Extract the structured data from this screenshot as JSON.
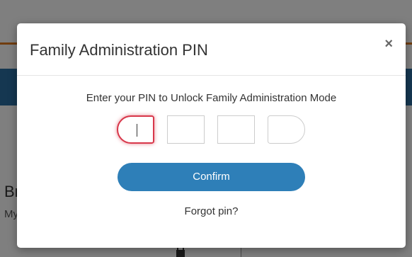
{
  "background": {
    "heading_fragment": "Br",
    "subtext_fragment": "My"
  },
  "modal": {
    "title": "Family Administration PIN",
    "close_label": "×",
    "prompt": "Enter your PIN to Unlock Family Administration Mode",
    "pin_digits": [
      "",
      "",
      "",
      ""
    ],
    "confirm_label": "Confirm",
    "forgot_label": "Forgot pin?"
  },
  "colors": {
    "accent_blue": "#2e7fb8",
    "focus_red": "#d8374a",
    "header_orange": "#e07b1f"
  }
}
